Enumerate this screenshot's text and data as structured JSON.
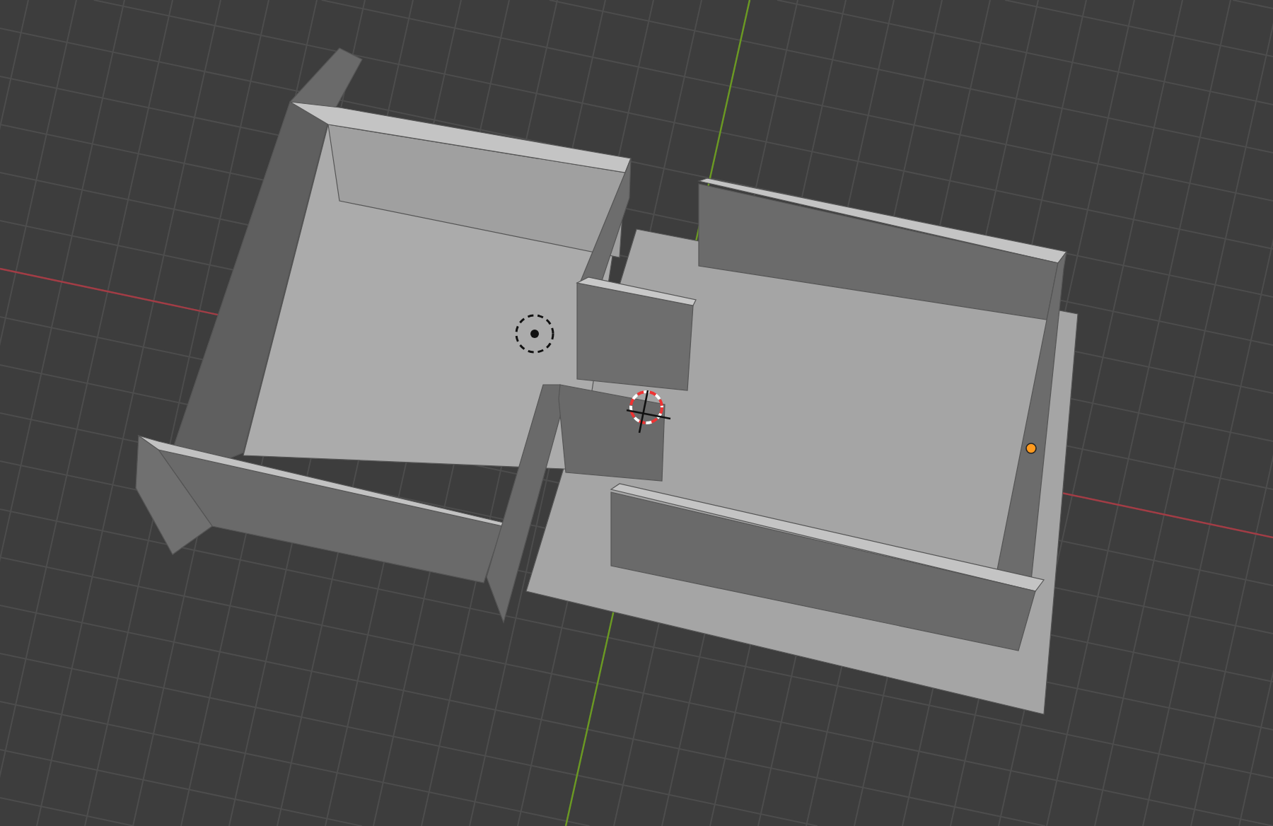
{
  "viewport": {
    "grid": true,
    "axes": true,
    "cursor": true,
    "light": true,
    "selected_origin": true
  }
}
